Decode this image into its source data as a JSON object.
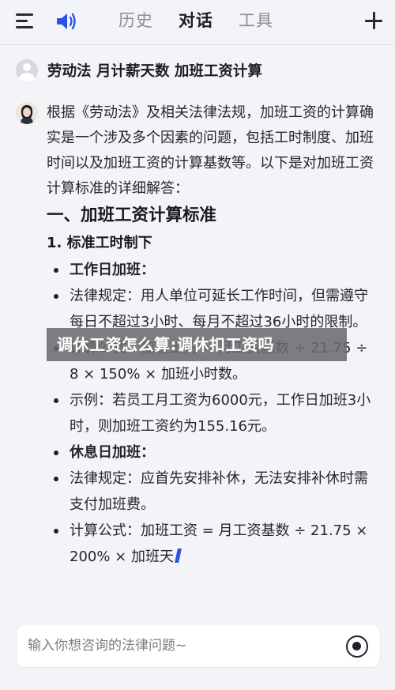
{
  "header": {
    "tabs": [
      {
        "label": "历史"
      },
      {
        "label": "对话"
      },
      {
        "label": "工具"
      }
    ],
    "active_tab": "对话",
    "icons": {
      "menu": "menu-icon",
      "speaker": "speaker-icon",
      "new": "plus-icon"
    }
  },
  "conversation": {
    "user_message": "劳动法 月计薪天数 加班工资计算",
    "answer": {
      "intro": "根据《劳动法》及相关法律法规，加班工资的计算确实是一个涉及多个因素的问题，包括工时制度、加班时间以及加班工资的计算基数等。以下是对加班工资计算标准的详细解答：",
      "heading": "一、加班工资计算标准",
      "subheading": "1. 标准工时制下",
      "bullets": [
        "工作日加班：",
        "法律规定：用人单位可延长工作时间，但需遵守每日不超过3小时、每月不超过36小时的限制。",
        "计算公式：加班工资 = 月工资基数 ÷ 21.75 ÷ 8 × 150% × 加班小时数。",
        "示例：若员工月工资为6000元，工作日加班3小时，则加班工资约为155.16元。",
        "休息日加班：",
        "法律规定：应首先安排补休，无法安排补休时需支付加班费。",
        "计算公式：加班工资 = 月工资基数 ÷ 21.75 × 200% × 加班天"
      ]
    }
  },
  "overlay": {
    "text": "调休工资怎么算:调休扣工资吗"
  },
  "input": {
    "placeholder": "输入你想咨询的法律问题~",
    "value": ""
  },
  "colors": {
    "accent": "#2b52e6",
    "background": "#f3f4f8"
  }
}
